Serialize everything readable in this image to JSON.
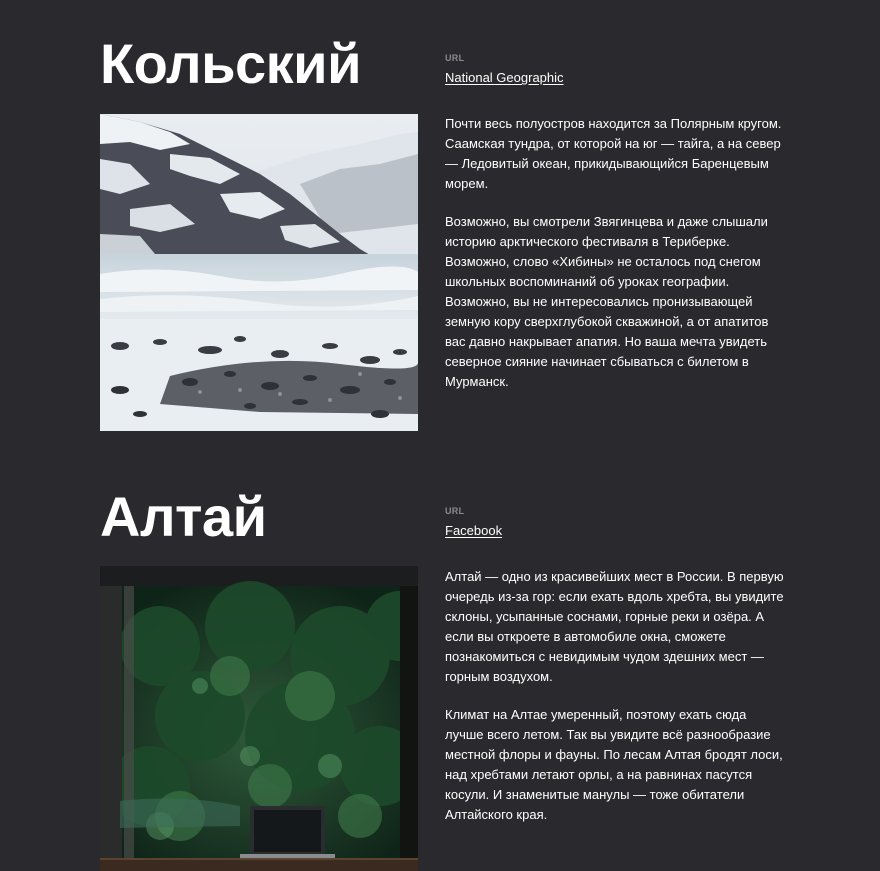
{
  "places": [
    {
      "title": "Кольский",
      "url_label": "URL",
      "link_text": "National Geographic",
      "image_icon": "snowy-mountain-coast-photo",
      "paragraphs": [
        "Почти весь полуостров находится за Полярным кругом. Саамская тундра, от которой на юг — тайга, а на север — Ледовитый океан, прикидывающийся Баренцевым морем.",
        "Возможно, вы смотрели Звягинцева и даже слышали историю арктического фестиваля в Териберке. Возможно, слово «Хибины» не осталось под снегом школьных воспоминаний об уроках географии. Возможно, вы не интересовались пронизывающей земную кору сверхглубокой скважиной, а от апатитов вас давно накрывает апатия. Но ваша мечта увидеть северное сияние начинает сбываться с билетом в Мурманск."
      ]
    },
    {
      "title": "Алтай",
      "url_label": "URL",
      "link_text": "Facebook",
      "image_icon": "forest-window-laptop-photo",
      "paragraphs": [
        "Алтай — одно из красивейших мест в России. В первую очередь из-за гор: если ехать вдоль хребта, вы увидите склоны, усыпанные соснами, горные реки и озёра. А если вы откроете в автомобиле окна, сможете познакомиться с невидимым чудом здешних мест — горным воздухом.",
        "Климат на Алтае умеренный, поэтому ехать сюда лучше всего летом. Так вы увидите всё разнообразие местной флоры и фауны. По лесам Алтая бродят лоси, над хребтами летают орлы, а на равнинах пасутся косули. И знаменитые манулы — тоже обитатели Алтайского края."
      ]
    }
  ]
}
